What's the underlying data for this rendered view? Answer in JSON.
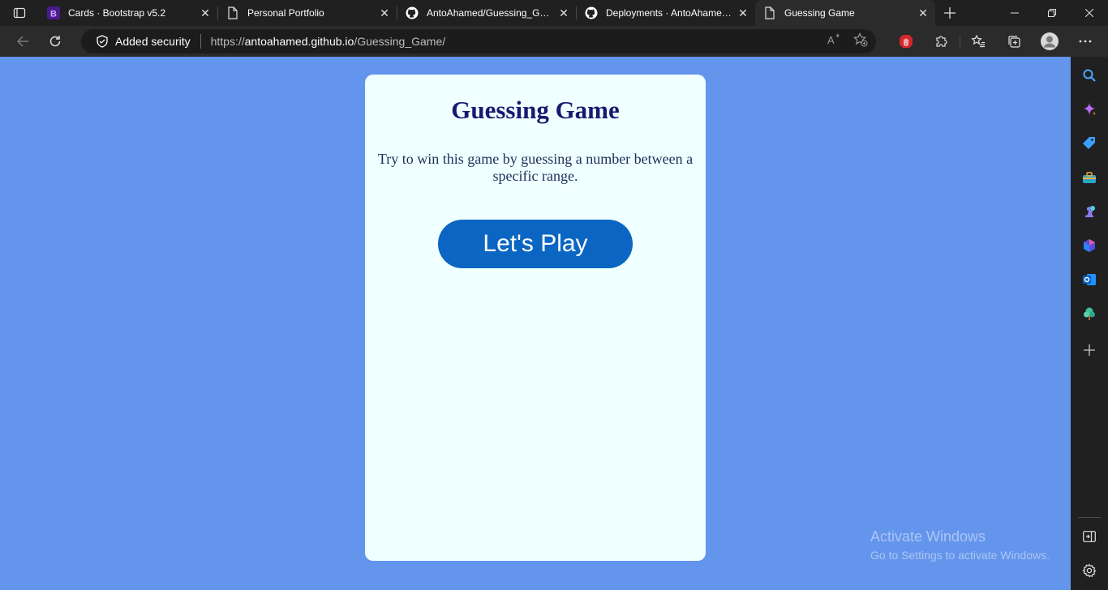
{
  "browser": {
    "tabs": [
      {
        "title": "Cards · Bootstrap v5.2",
        "icon": "bootstrap-icon",
        "active": false
      },
      {
        "title": "Personal Portfolio",
        "icon": "page-icon",
        "active": false
      },
      {
        "title": "AntoAhamed/Guessing_Game",
        "icon": "github-icon",
        "active": false
      },
      {
        "title": "Deployments · AntoAhamed/Guessing_Game",
        "icon": "github-icon",
        "active": false
      },
      {
        "title": "Guessing Game",
        "icon": "page-icon",
        "active": true
      }
    ],
    "security_label": "Added security",
    "url_prefix": "https://",
    "url_host": "antoahamed.github.io",
    "url_path": "/Guessing_Game/",
    "accent": "#6495ed"
  },
  "card": {
    "title": "Guessing Game",
    "description": "Try to win this game by guessing a number between a specific range.",
    "play_label": "Let's Play"
  },
  "watermark": {
    "title": "Activate Windows",
    "subtitle": "Go to Settings to activate Windows."
  }
}
